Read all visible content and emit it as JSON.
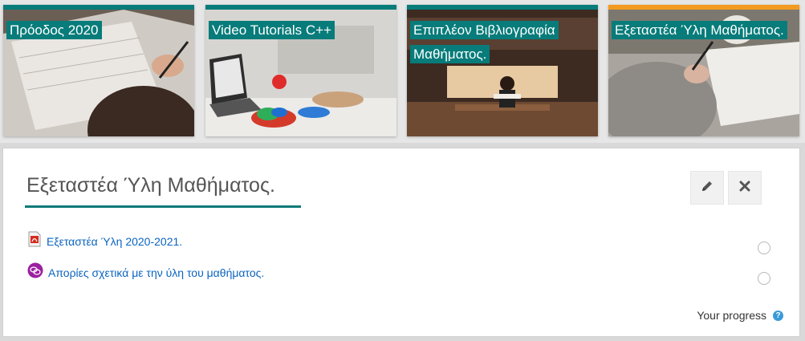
{
  "tiles": [
    {
      "label": "Πρόοδος 2020",
      "bar_color": "#077c7a"
    },
    {
      "label": "Video Tutorials C++",
      "bar_color": "#077c7a"
    },
    {
      "label": "Επιπλέον Βιβλιογραφία Μαθήματος.",
      "bar_color": "#077c7a"
    },
    {
      "label": "Εξεταστέα Ύλη Μαθήματος.",
      "bar_color": "#f29b20"
    }
  ],
  "section": {
    "title": "Εξεταστέα Ύλη Μαθήματος.",
    "edit_icon": "pencil-icon",
    "close_icon": "close-icon"
  },
  "activities": [
    {
      "icon": "pdf-icon",
      "label": "Εξεταστέα Ύλη 2020-2021."
    },
    {
      "icon": "forum-icon",
      "label": "Απορίες σχετικά με την ύλη του μαθήματος."
    }
  ],
  "footer": {
    "progress_label": "Your progress",
    "help_icon": "?"
  },
  "colors": {
    "accent": "#077c7a",
    "selected": "#f29b20",
    "link": "#0b64c0"
  }
}
